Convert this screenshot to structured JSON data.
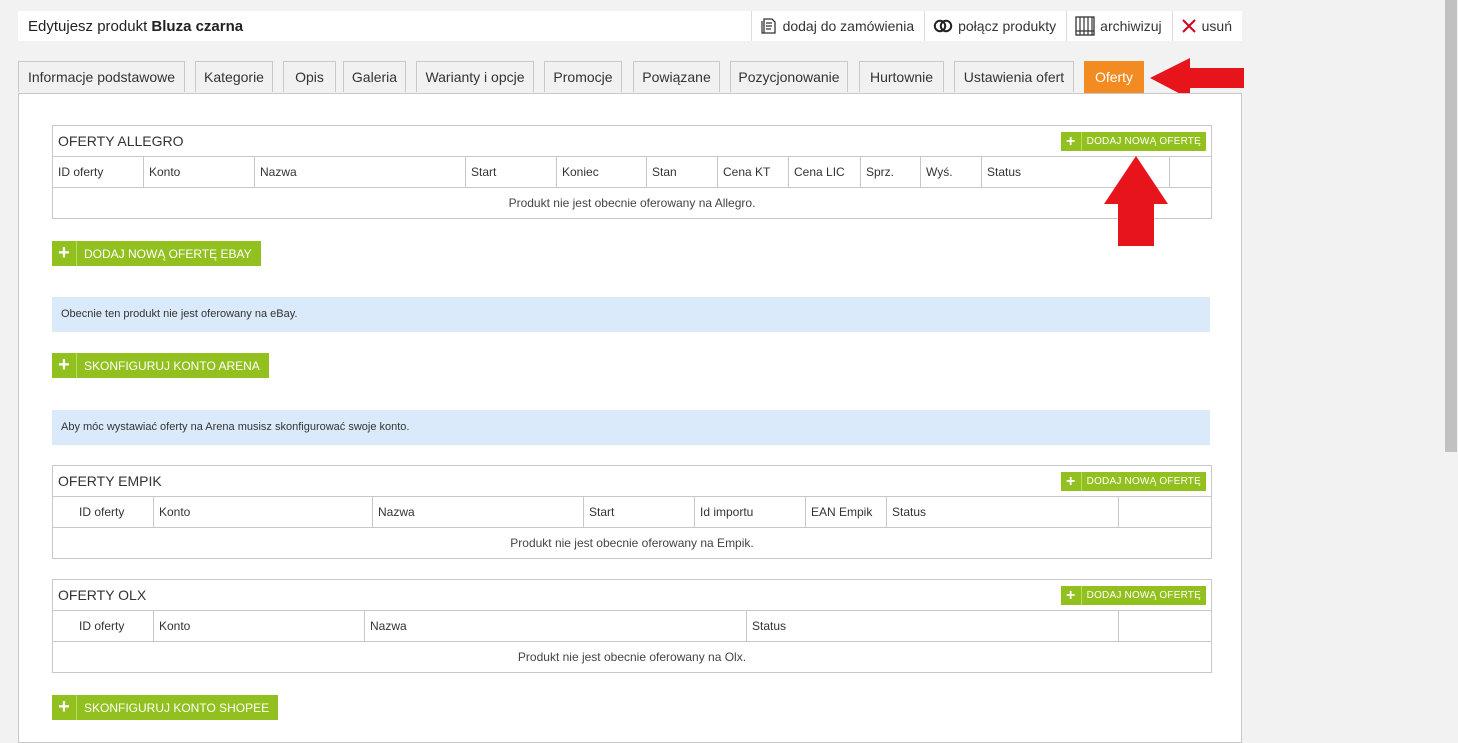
{
  "header": {
    "title_prefix": "Edytujesz produkt ",
    "product_name": "Bluza czarna",
    "actions": [
      {
        "label": "dodaj do zamówienia",
        "icon": "order-icon"
      },
      {
        "label": "połącz produkty",
        "icon": "link-icon"
      },
      {
        "label": "archiwizuj",
        "icon": "archive-icon"
      },
      {
        "label": "usuń",
        "icon": "close-icon"
      }
    ]
  },
  "tabs": [
    {
      "label": "Informacje podstawowe"
    },
    {
      "label": "Kategorie"
    },
    {
      "label": "Opis"
    },
    {
      "label": "Galeria"
    },
    {
      "label": "Warianty i opcje"
    },
    {
      "label": "Promocje"
    },
    {
      "label": "Powiązane"
    },
    {
      "label": "Pozycjonowanie"
    },
    {
      "label": "Hurtownie"
    },
    {
      "label": "Ustawienia ofert"
    },
    {
      "label": "Oferty",
      "active": true
    }
  ],
  "allegro": {
    "title": "OFERTY ALLEGRO",
    "add_label": "DODAJ NOWĄ OFERTĘ",
    "columns": [
      "ID oferty",
      "Konto",
      "Nazwa",
      "Start",
      "Koniec",
      "Stan",
      "Cena KT",
      "Cena LIC",
      "Sprz.",
      "Wyś.",
      "Status",
      ""
    ],
    "empty": "Produkt nie jest obecnie oferowany na Allegro."
  },
  "ebay": {
    "button": "DODAJ NOWĄ OFERTĘ EBAY",
    "info": "Obecnie ten produkt nie jest oferowany na eBay."
  },
  "arena": {
    "button": "SKONFIGURUJ KONTO ARENA",
    "info": "Aby móc wystawiać oferty na Arena musisz skonfigurować swoje konto."
  },
  "empik": {
    "title": "OFERTY EMPIK",
    "add_label": "DODAJ NOWĄ OFERTĘ",
    "columns": [
      "ID oferty",
      "Konto",
      "Nazwa",
      "Start",
      "Id importu",
      "EAN Empik",
      "Status",
      ""
    ],
    "empty": "Produkt nie jest obecnie oferowany na Empik."
  },
  "olx": {
    "title": "OFERTY OLX",
    "add_label": "DODAJ NOWĄ OFERTĘ",
    "columns": [
      "ID oferty",
      "Konto",
      "Nazwa",
      "Status",
      ""
    ],
    "empty": "Produkt nie jest obecnie oferowany na Olx."
  },
  "shopee": {
    "button": "SKONFIGURUJ KONTO SHOPEE"
  },
  "colors": {
    "accent_orange": "#f28b21",
    "button_green": "#92c11f",
    "info_blue": "#dbeafa",
    "arrow_red": "#e8141c"
  }
}
